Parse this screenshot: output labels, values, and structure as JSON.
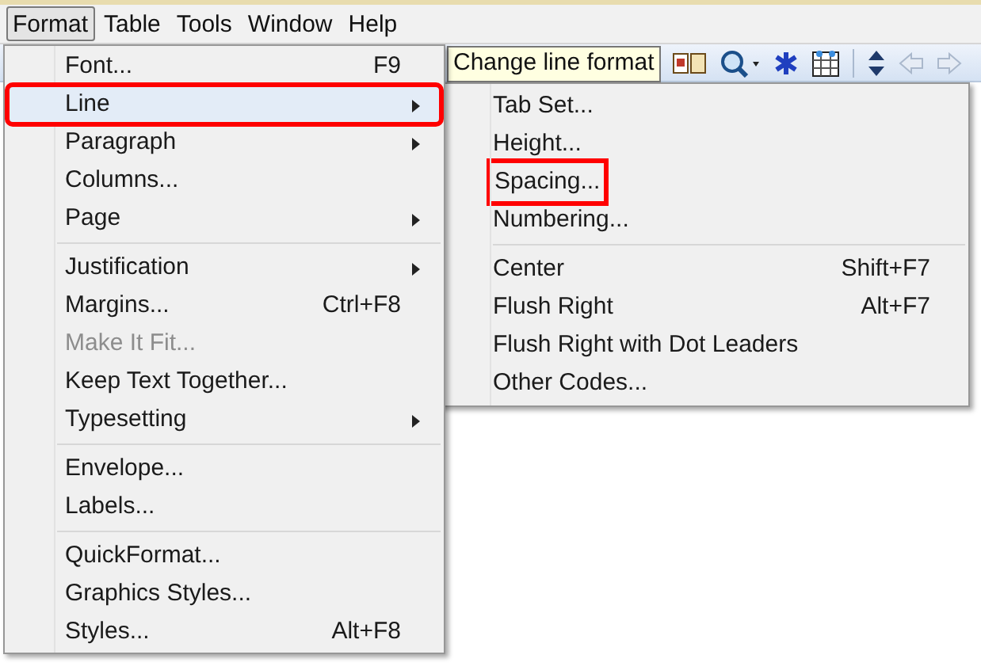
{
  "menubar": [
    {
      "label": "Format",
      "selected": true
    },
    {
      "label": "Table",
      "selected": false
    },
    {
      "label": "Tools",
      "selected": false
    },
    {
      "label": "Window",
      "selected": false
    },
    {
      "label": "Help",
      "selected": false
    }
  ],
  "tooltip": "Change line format",
  "menu": {
    "groups": [
      [
        {
          "label": "Font...",
          "shortcut": "F9",
          "submenu": false,
          "disabled": false,
          "highlighted": false,
          "annotated": false
        },
        {
          "label": "Line",
          "submenu": true,
          "disabled": false,
          "highlighted": true,
          "annotated": true
        },
        {
          "label": "Paragraph",
          "submenu": true,
          "disabled": false,
          "highlighted": false,
          "annotated": false
        },
        {
          "label": "Columns...",
          "submenu": false,
          "disabled": false,
          "highlighted": false,
          "annotated": false
        },
        {
          "label": "Page",
          "submenu": true,
          "disabled": false,
          "highlighted": false,
          "annotated": false
        }
      ],
      [
        {
          "label": "Justification",
          "submenu": true,
          "disabled": false,
          "highlighted": false,
          "annotated": false
        },
        {
          "label": "Margins...",
          "shortcut": "Ctrl+F8",
          "submenu": false,
          "disabled": false,
          "highlighted": false,
          "annotated": false
        },
        {
          "label": "Make It Fit...",
          "submenu": false,
          "disabled": true,
          "highlighted": false,
          "annotated": false
        },
        {
          "label": "Keep Text Together...",
          "submenu": false,
          "disabled": false,
          "highlighted": false,
          "annotated": false
        },
        {
          "label": "Typesetting",
          "submenu": true,
          "disabled": false,
          "highlighted": false,
          "annotated": false
        }
      ],
      [
        {
          "label": "Envelope...",
          "submenu": false,
          "disabled": false,
          "highlighted": false,
          "annotated": false
        },
        {
          "label": "Labels...",
          "submenu": false,
          "disabled": false,
          "highlighted": false,
          "annotated": false
        }
      ],
      [
        {
          "label": "QuickFormat...",
          "submenu": false,
          "disabled": false,
          "highlighted": false,
          "annotated": false
        },
        {
          "label": "Graphics Styles...",
          "submenu": false,
          "disabled": false,
          "highlighted": false,
          "annotated": false
        },
        {
          "label": "Styles...",
          "shortcut": "Alt+F8",
          "submenu": false,
          "disabled": false,
          "highlighted": false,
          "annotated": false
        }
      ]
    ]
  },
  "submenu": {
    "groups": [
      [
        {
          "label": "Tab Set...",
          "annotated": false
        },
        {
          "label": "Height...",
          "annotated": false
        },
        {
          "label": "Spacing...",
          "annotated": true
        },
        {
          "label": "Numbering...",
          "annotated": false
        }
      ],
      [
        {
          "label": "Center",
          "shortcut": "Shift+F7",
          "annotated": false
        },
        {
          "label": "Flush Right",
          "shortcut": "Alt+F7",
          "annotated": false
        },
        {
          "label": "Flush Right with Dot Leaders",
          "annotated": false
        },
        {
          "label": "Other Codes...",
          "annotated": false
        }
      ]
    ]
  }
}
